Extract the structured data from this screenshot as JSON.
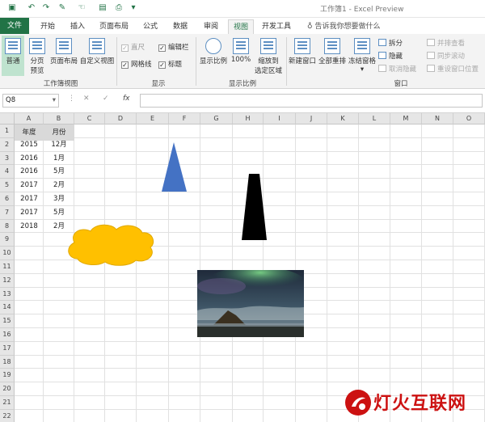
{
  "window": {
    "title": "工作簿1 - Excel Preview"
  },
  "quick_access": {
    "icons": [
      "save-icon",
      "undo-icon",
      "redo-icon",
      "paint-icon",
      "touch-icon",
      "customize-icon"
    ]
  },
  "tabs": [
    {
      "label": "文件"
    },
    {
      "label": "开始"
    },
    {
      "label": "插入"
    },
    {
      "label": "页面布局"
    },
    {
      "label": "公式"
    },
    {
      "label": "数据"
    },
    {
      "label": "审阅"
    },
    {
      "label": "视图"
    },
    {
      "label": "开发工具"
    }
  ],
  "tell_me": {
    "placeholder": "告诉我你想要做什么",
    "icon": "lightbulb-icon"
  },
  "ribbon": {
    "workbook_views": {
      "label": "工作簿视图",
      "normal": "普通",
      "page_break_line1": "分页",
      "page_break_line2": "预览",
      "page_layout": "页面布局",
      "custom_views": "自定义视图"
    },
    "show": {
      "label": "显示",
      "ruler": "直尺",
      "formula_bar": "编辑栏",
      "gridlines": "网格线",
      "headings": "标题"
    },
    "zoom": {
      "label": "显示比例",
      "zoom_btn": "显示比例",
      "hundred": "100%",
      "selection_line1": "缩放到",
      "selection_line2": "选定区域"
    },
    "window": {
      "label": "窗口",
      "new_window": "新建窗口",
      "arrange_all": "全部重排",
      "freeze": "冻结窗格",
      "split": "拆分",
      "hide": "隐藏",
      "unhide": "取消隐藏",
      "side_by_side": "并排查看",
      "sync_scroll": "同步滚动",
      "reset_position": "重设窗口位置"
    }
  },
  "formula_bar": {
    "name_box": "Q8",
    "cancel": "✕",
    "enter": "✓",
    "fx": "fx",
    "value": ""
  },
  "grid": {
    "columns": [
      "A",
      "B",
      "C",
      "D",
      "E",
      "F",
      "G",
      "H",
      "I",
      "J",
      "K",
      "L",
      "M",
      "N",
      "O"
    ],
    "rows": [
      "1",
      "2",
      "3",
      "4",
      "5",
      "6",
      "7",
      "8",
      "9",
      "10",
      "11",
      "12",
      "13",
      "14",
      "15",
      "16",
      "17",
      "18",
      "19",
      "20",
      "21",
      "22"
    ],
    "table_header": [
      "年度",
      "月份"
    ],
    "table_rows": [
      [
        "2015",
        "12月"
      ],
      [
        "2016",
        "1月"
      ],
      [
        "2016",
        "5月"
      ],
      [
        "2017",
        "2月"
      ],
      [
        "2017",
        "3月"
      ],
      [
        "2017",
        "5月"
      ],
      [
        "2018",
        "2月"
      ]
    ]
  },
  "shapes": {
    "triangle_color": "#4472c4",
    "trapezoid_color": "#000000",
    "cloud_color": "#ffc000",
    "cloud_outline": "#e0a800"
  },
  "watermark": {
    "text": "灯火互联网",
    "color": "#cc1111"
  },
  "colors": {
    "accent": "#217346",
    "selected_view": "#bfe3cf"
  }
}
